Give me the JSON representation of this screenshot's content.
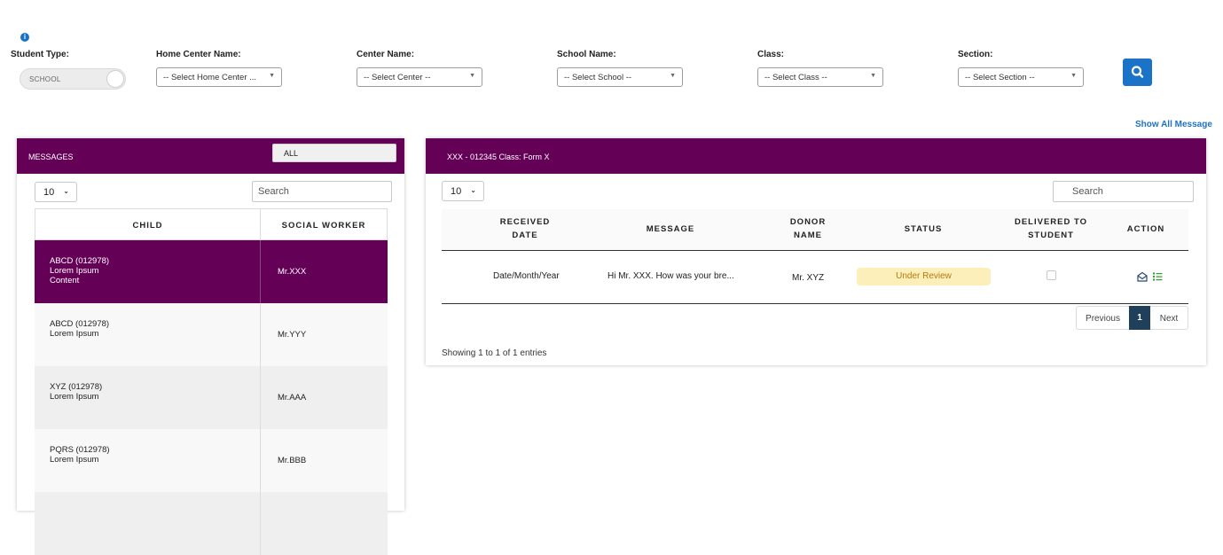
{
  "filters": {
    "info_icon": "info-icon",
    "student_type": {
      "label": "Student Type:",
      "toggle_value": "SCHOOL"
    },
    "home_center": {
      "label": "Home Center Name:",
      "value": "-- Select Home Center ..."
    },
    "center": {
      "label": "Center Name:",
      "value": "-- Select Center --"
    },
    "school": {
      "label": "School Name:",
      "value": "-- Select School --"
    },
    "class": {
      "label": "Class:",
      "value": "-- Select Class --"
    },
    "section": {
      "label": "Section:",
      "value": "-- Select Section --"
    },
    "search_icon": "search-icon"
  },
  "show_all_label": "Show All Message",
  "messages_panel": {
    "title": "MESSAGES",
    "filter_button": "ALL",
    "page_length": "10",
    "search_placeholder": "Search",
    "columns": [
      "CHILD",
      "SOCIAL WORKER"
    ],
    "rows": [
      {
        "child": [
          "ABCD (012978)",
          "Lorem Ipsum",
          "Content"
        ],
        "worker": "Mr.XXX"
      },
      {
        "child": [
          "ABCD (012978)",
          "Lorem Ipsum"
        ],
        "worker": "Mr.YYY"
      },
      {
        "child": [
          "XYZ (012978)",
          "Lorem Ipsum"
        ],
        "worker": "Mr.AAA"
      },
      {
        "child": [
          "PQRS (012978)",
          "Lorem Ipsum"
        ],
        "worker": "Mr.BBB"
      }
    ]
  },
  "detail_panel": {
    "title": "XXX - 012345 Class: Form X",
    "page_length": "10",
    "search_placeholder": "Search",
    "columns": {
      "received_date": [
        "RECEIVED",
        "DATE"
      ],
      "message": "MESSAGE",
      "donor_name": [
        "DONOR",
        "NAME"
      ],
      "status": "STATUS",
      "delivered": [
        "DELIVERED TO",
        "STUDENT"
      ],
      "action": "ACTION"
    },
    "row": {
      "received_date": "Date/Month/Year",
      "message": "Hi Mr. XXX. How was your bre...",
      "donor_name": "Mr. XYZ",
      "status": "Under Review",
      "delivered": false,
      "actions": [
        "envelope-open-icon",
        "list-icon"
      ]
    },
    "pagination": {
      "previous": "Previous",
      "current": "1",
      "next": "Next"
    },
    "showing": "Showing 1 to 1 of 1 entries"
  },
  "colors": {
    "brand_purple": "#650057",
    "accent_blue": "#1b73c8",
    "status_bg": "#fdefb9",
    "status_text": "#b37a10",
    "action_green": "#2e9e2e"
  }
}
